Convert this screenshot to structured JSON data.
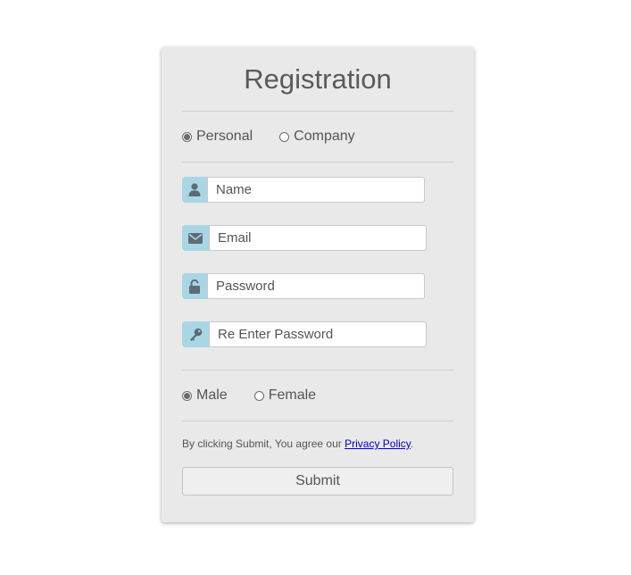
{
  "form": {
    "title": "Registration",
    "account_type": {
      "options": [
        "Personal",
        "Company"
      ],
      "selected": "Personal"
    },
    "fields": {
      "name_placeholder": "Name",
      "email_placeholder": "Email",
      "password_placeholder": "Password",
      "reenter_password_placeholder": "Re Enter Password"
    },
    "gender": {
      "options": [
        "Male",
        "Female"
      ],
      "selected": "Male"
    },
    "terms": {
      "text": "By clicking Submit, You agree our ",
      "link_text": "Privacy Policy",
      "suffix": "."
    },
    "submit_label": "Submit"
  },
  "icons": {
    "name": "user-icon",
    "email": "envelope-icon",
    "password": "unlock-icon",
    "reenter_password": "key-icon"
  },
  "colors": {
    "card_background": "#e9e9e9",
    "addon_background": "#a9d6e5",
    "icon_color": "#5f6b73",
    "link_color": "#0000cc"
  }
}
